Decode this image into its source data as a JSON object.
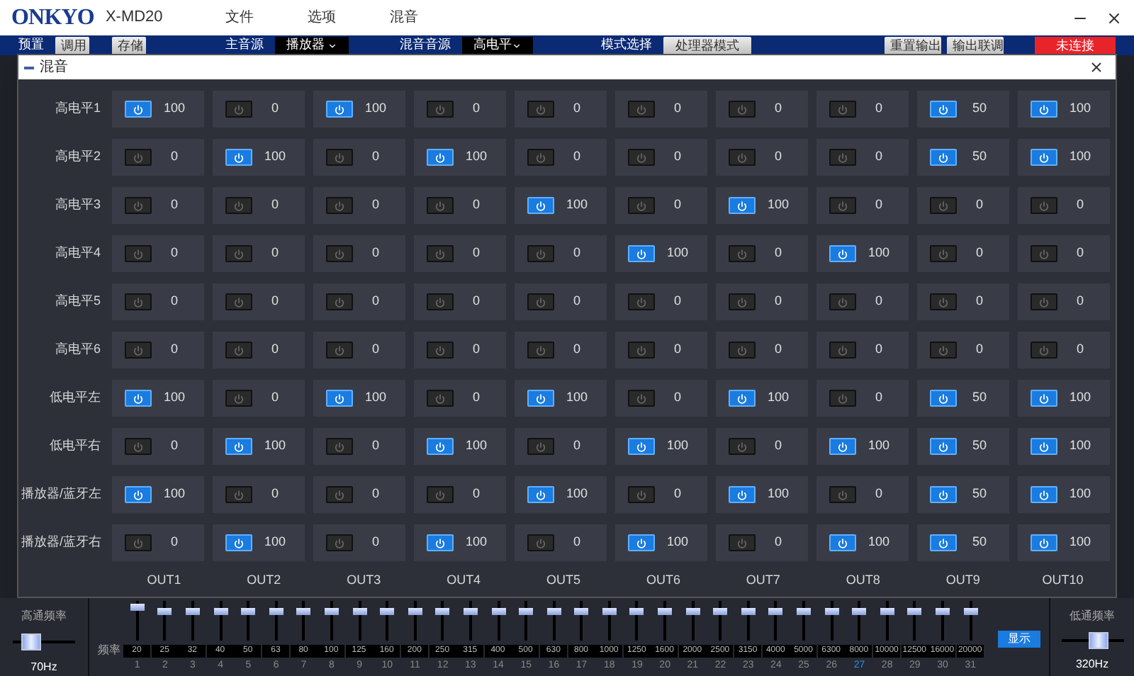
{
  "app": {
    "logo": "ONKYO",
    "model": "X-MD20",
    "menus": [
      "文件",
      "选项",
      "混音"
    ]
  },
  "toolbar": {
    "preset_label": "预置",
    "preset_buttons": [
      "调用",
      "存储"
    ],
    "main_source_label": "主音源",
    "main_source": "播放器",
    "mix_source_label": "混音音源",
    "mix_source": "高电平",
    "mode_label": "模式选择",
    "mode": "处理器模式",
    "actions": [
      "重置输出",
      "输出联调"
    ],
    "status": "未连接"
  },
  "dialog": {
    "title": "混音",
    "outputs": [
      "OUT1",
      "OUT2",
      "OUT3",
      "OUT4",
      "OUT5",
      "OUT6",
      "OUT7",
      "OUT8",
      "OUT9",
      "OUT10"
    ],
    "rows": [
      {
        "label": "高电平1",
        "cells": [
          {
            "on": true,
            "value": "100"
          },
          {
            "on": false,
            "value": "0"
          },
          {
            "on": true,
            "value": "100"
          },
          {
            "on": false,
            "value": "0"
          },
          {
            "on": false,
            "value": "0"
          },
          {
            "on": false,
            "value": "0"
          },
          {
            "on": false,
            "value": "0"
          },
          {
            "on": false,
            "value": "0"
          },
          {
            "on": true,
            "value": "50"
          },
          {
            "on": true,
            "value": "100"
          }
        ]
      },
      {
        "label": "高电平2",
        "cells": [
          {
            "on": false,
            "value": "0"
          },
          {
            "on": true,
            "value": "100"
          },
          {
            "on": false,
            "value": "0"
          },
          {
            "on": true,
            "value": "100"
          },
          {
            "on": false,
            "value": "0"
          },
          {
            "on": false,
            "value": "0"
          },
          {
            "on": false,
            "value": "0"
          },
          {
            "on": false,
            "value": "0"
          },
          {
            "on": true,
            "value": "50"
          },
          {
            "on": true,
            "value": "100"
          }
        ]
      },
      {
        "label": "高电平3",
        "cells": [
          {
            "on": false,
            "value": "0"
          },
          {
            "on": false,
            "value": "0"
          },
          {
            "on": false,
            "value": "0"
          },
          {
            "on": false,
            "value": "0"
          },
          {
            "on": true,
            "value": "100"
          },
          {
            "on": false,
            "value": "0"
          },
          {
            "on": true,
            "value": "100"
          },
          {
            "on": false,
            "value": "0"
          },
          {
            "on": false,
            "value": "0"
          },
          {
            "on": false,
            "value": "0"
          }
        ]
      },
      {
        "label": "高电平4",
        "cells": [
          {
            "on": false,
            "value": "0"
          },
          {
            "on": false,
            "value": "0"
          },
          {
            "on": false,
            "value": "0"
          },
          {
            "on": false,
            "value": "0"
          },
          {
            "on": false,
            "value": "0"
          },
          {
            "on": true,
            "value": "100"
          },
          {
            "on": false,
            "value": "0"
          },
          {
            "on": true,
            "value": "100"
          },
          {
            "on": false,
            "value": "0"
          },
          {
            "on": false,
            "value": "0"
          }
        ]
      },
      {
        "label": "高电平5",
        "cells": [
          {
            "on": false,
            "value": "0"
          },
          {
            "on": false,
            "value": "0"
          },
          {
            "on": false,
            "value": "0"
          },
          {
            "on": false,
            "value": "0"
          },
          {
            "on": false,
            "value": "0"
          },
          {
            "on": false,
            "value": "0"
          },
          {
            "on": false,
            "value": "0"
          },
          {
            "on": false,
            "value": "0"
          },
          {
            "on": false,
            "value": "0"
          },
          {
            "on": false,
            "value": "0"
          }
        ]
      },
      {
        "label": "高电平6",
        "cells": [
          {
            "on": false,
            "value": "0"
          },
          {
            "on": false,
            "value": "0"
          },
          {
            "on": false,
            "value": "0"
          },
          {
            "on": false,
            "value": "0"
          },
          {
            "on": false,
            "value": "0"
          },
          {
            "on": false,
            "value": "0"
          },
          {
            "on": false,
            "value": "0"
          },
          {
            "on": false,
            "value": "0"
          },
          {
            "on": false,
            "value": "0"
          },
          {
            "on": false,
            "value": "0"
          }
        ]
      },
      {
        "label": "低电平左",
        "cells": [
          {
            "on": true,
            "value": "100"
          },
          {
            "on": false,
            "value": "0"
          },
          {
            "on": true,
            "value": "100"
          },
          {
            "on": false,
            "value": "0"
          },
          {
            "on": true,
            "value": "100"
          },
          {
            "on": false,
            "value": "0"
          },
          {
            "on": true,
            "value": "100"
          },
          {
            "on": false,
            "value": "0"
          },
          {
            "on": true,
            "value": "50"
          },
          {
            "on": true,
            "value": "100"
          }
        ]
      },
      {
        "label": "低电平右",
        "cells": [
          {
            "on": false,
            "value": "0"
          },
          {
            "on": true,
            "value": "100"
          },
          {
            "on": false,
            "value": "0"
          },
          {
            "on": true,
            "value": "100"
          },
          {
            "on": false,
            "value": "0"
          },
          {
            "on": true,
            "value": "100"
          },
          {
            "on": false,
            "value": "0"
          },
          {
            "on": true,
            "value": "100"
          },
          {
            "on": true,
            "value": "50"
          },
          {
            "on": true,
            "value": "100"
          }
        ]
      },
      {
        "label": "播放器/蓝牙左",
        "cells": [
          {
            "on": true,
            "value": "100"
          },
          {
            "on": false,
            "value": "0"
          },
          {
            "on": false,
            "value": "0"
          },
          {
            "on": false,
            "value": "0"
          },
          {
            "on": true,
            "value": "100"
          },
          {
            "on": false,
            "value": "0"
          },
          {
            "on": true,
            "value": "100"
          },
          {
            "on": false,
            "value": "0"
          },
          {
            "on": true,
            "value": "50"
          },
          {
            "on": true,
            "value": "100"
          }
        ]
      },
      {
        "label": "播放器/蓝牙右",
        "cells": [
          {
            "on": false,
            "value": "0"
          },
          {
            "on": true,
            "value": "100"
          },
          {
            "on": false,
            "value": "0"
          },
          {
            "on": true,
            "value": "100"
          },
          {
            "on": false,
            "value": "0"
          },
          {
            "on": true,
            "value": "100"
          },
          {
            "on": false,
            "value": "0"
          },
          {
            "on": true,
            "value": "100"
          },
          {
            "on": true,
            "value": "50"
          },
          {
            "on": true,
            "value": "100"
          }
        ]
      }
    ]
  },
  "highpass": {
    "label": "高通频率",
    "level": 0.3,
    "reading": "70Hz"
  },
  "lowpass": {
    "label": "低通频率",
    "level": 0.6,
    "reading": "320Hz"
  },
  "eq": {
    "freq_label": "频率",
    "show_button": "显示",
    "bands": [
      {
        "freq": "20",
        "index": "1",
        "level": 0.9,
        "selected": false
      },
      {
        "freq": "25",
        "index": "2",
        "level": 0.8,
        "selected": false
      },
      {
        "freq": "32",
        "index": "3",
        "level": 0.8,
        "selected": false
      },
      {
        "freq": "40",
        "index": "4",
        "level": 0.8,
        "selected": false
      },
      {
        "freq": "50",
        "index": "5",
        "level": 0.8,
        "selected": false
      },
      {
        "freq": "63",
        "index": "6",
        "level": 0.8,
        "selected": false
      },
      {
        "freq": "80",
        "index": "7",
        "level": 0.8,
        "selected": false
      },
      {
        "freq": "100",
        "index": "8",
        "level": 0.8,
        "selected": false
      },
      {
        "freq": "125",
        "index": "9",
        "level": 0.8,
        "selected": false
      },
      {
        "freq": "160",
        "index": "10",
        "level": 0.8,
        "selected": false
      },
      {
        "freq": "200",
        "index": "11",
        "level": 0.8,
        "selected": false
      },
      {
        "freq": "250",
        "index": "12",
        "level": 0.8,
        "selected": false
      },
      {
        "freq": "315",
        "index": "13",
        "level": 0.8,
        "selected": false
      },
      {
        "freq": "400",
        "index": "14",
        "level": 0.8,
        "selected": false
      },
      {
        "freq": "500",
        "index": "15",
        "level": 0.8,
        "selected": false
      },
      {
        "freq": "630",
        "index": "16",
        "level": 0.8,
        "selected": false
      },
      {
        "freq": "800",
        "index": "17",
        "level": 0.8,
        "selected": false
      },
      {
        "freq": "1000",
        "index": "18",
        "level": 0.8,
        "selected": false
      },
      {
        "freq": "1250",
        "index": "19",
        "level": 0.8,
        "selected": false
      },
      {
        "freq": "1600",
        "index": "20",
        "level": 0.8,
        "selected": false
      },
      {
        "freq": "2000",
        "index": "21",
        "level": 0.8,
        "selected": false
      },
      {
        "freq": "2500",
        "index": "22",
        "level": 0.8,
        "selected": false
      },
      {
        "freq": "3150",
        "index": "23",
        "level": 0.8,
        "selected": false
      },
      {
        "freq": "4000",
        "index": "24",
        "level": 0.8,
        "selected": false
      },
      {
        "freq": "5000",
        "index": "25",
        "level": 0.8,
        "selected": false
      },
      {
        "freq": "6300",
        "index": "26",
        "level": 0.8,
        "selected": false
      },
      {
        "freq": "8000",
        "index": "27",
        "level": 0.8,
        "selected": true
      },
      {
        "freq": "10000",
        "index": "28",
        "level": 0.8,
        "selected": false
      },
      {
        "freq": "12500",
        "index": "29",
        "level": 0.8,
        "selected": false
      },
      {
        "freq": "16000",
        "index": "30",
        "level": 0.8,
        "selected": false
      },
      {
        "freq": "20000",
        "index": "31",
        "level": 0.8,
        "selected": false
      }
    ]
  }
}
